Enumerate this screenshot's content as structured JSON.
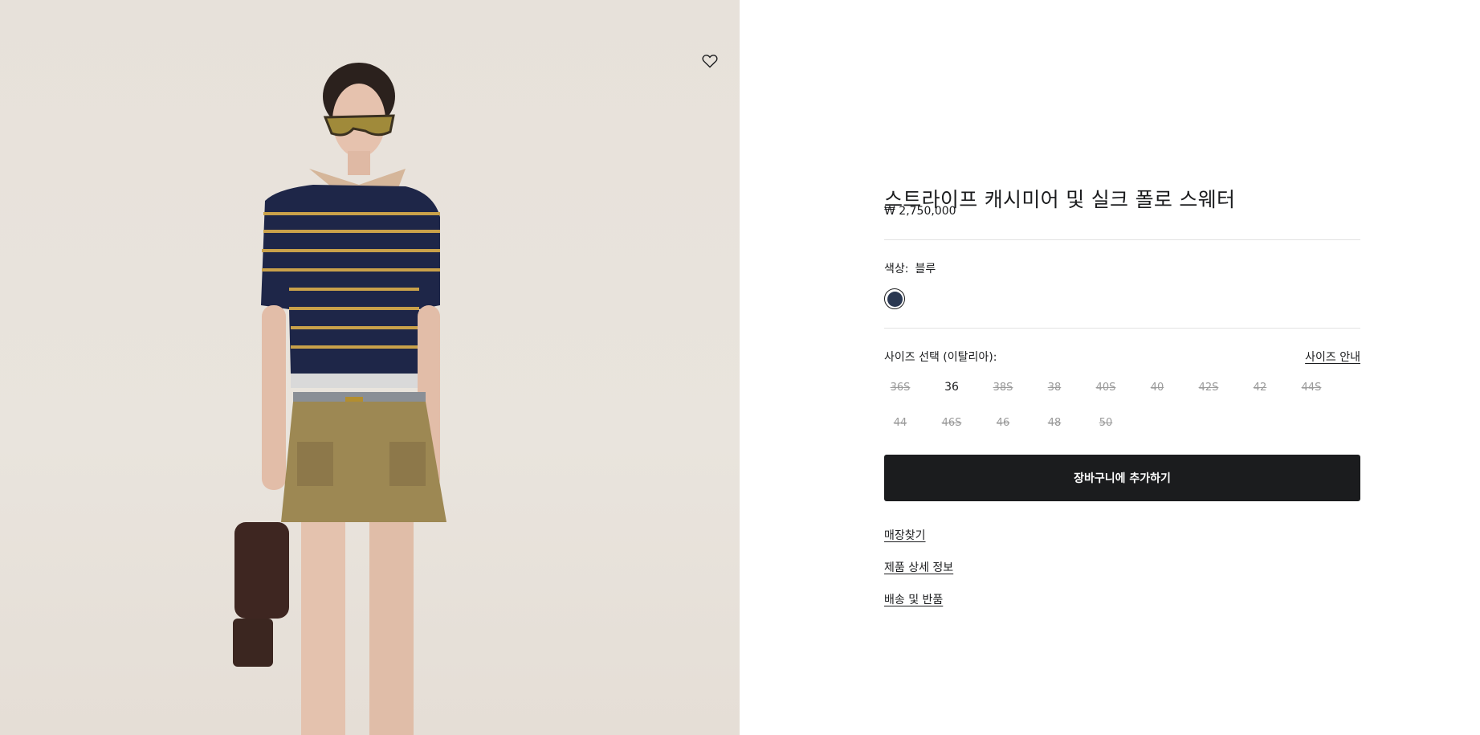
{
  "product": {
    "title": "스트라이프 캐시미어 및 실크 폴로 스웨터",
    "price": "₩ 2,750,000"
  },
  "color": {
    "label": "색상:",
    "value": "블루",
    "swatch_color": "#2a3852"
  },
  "size": {
    "label": "사이즈 선택 (이탈리아):",
    "guide_label": "사이즈 안내",
    "options": [
      {
        "label": "36S",
        "available": false
      },
      {
        "label": "36",
        "available": true
      },
      {
        "label": "38S",
        "available": false
      },
      {
        "label": "38",
        "available": false
      },
      {
        "label": "40S",
        "available": false
      },
      {
        "label": "40",
        "available": false
      },
      {
        "label": "42S",
        "available": false
      },
      {
        "label": "42",
        "available": false
      },
      {
        "label": "44S",
        "available": false
      },
      {
        "label": "44",
        "available": false
      },
      {
        "label": "46S",
        "available": false
      },
      {
        "label": "46",
        "available": false
      },
      {
        "label": "48",
        "available": false
      },
      {
        "label": "50",
        "available": false
      }
    ]
  },
  "actions": {
    "add_to_cart": "장바구니에 추가하기",
    "find_store": "매장찾기",
    "product_details": "제품 상세 정보",
    "shipping_returns": "배송 및 반품"
  },
  "icons": {
    "wishlist": "heart-icon"
  },
  "colors": {
    "button_bg": "#1b1c1e",
    "photo_bg": "#e8e2db"
  }
}
